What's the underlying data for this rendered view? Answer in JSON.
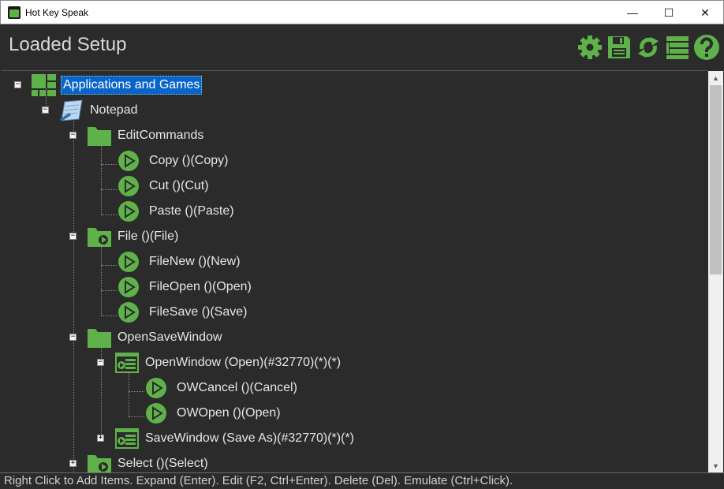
{
  "window": {
    "title": "Hot Key Speak",
    "minimize_glyph": "—",
    "maximize_glyph": "☐",
    "close_glyph": "✕"
  },
  "header": {
    "title": "Loaded Setup"
  },
  "toolbar": [
    {
      "name": "settings-gear-icon"
    },
    {
      "name": "save-disk-icon"
    },
    {
      "name": "refresh-icon"
    },
    {
      "name": "list-icon"
    },
    {
      "name": "help-icon"
    }
  ],
  "colors": {
    "accent_green": "#5fb24a",
    "selection_blue": "#0a64c8",
    "background": "#2b2b2b"
  },
  "tree": {
    "applications": "Applications and Games",
    "notepad": "Notepad",
    "edit_commands": "EditCommands",
    "copy": "Copy ()(Copy)",
    "cut": "Cut ()(Cut)",
    "paste": "Paste ()(Paste)",
    "file": "File ()(File)",
    "file_new": "FileNew ()(New)",
    "file_open": "FileOpen ()(Open)",
    "file_save": "FileSave ()(Save)",
    "open_save_window": "OpenSaveWindow",
    "open_window": "OpenWindow (Open)(#32770)(*)(*)",
    "ow_cancel": "OWCancel ()(Cancel)",
    "ow_open": "OWOpen ()(Open)",
    "save_window": "SaveWindow (Save As)(#32770)(*)(*)",
    "select": "Select ()(Select)"
  },
  "status": {
    "text": "Right Click to Add Items. Expand (Enter). Edit (F2, Ctrl+Enter). Delete (Del). Emulate (Ctrl+Click)."
  },
  "scroll": {
    "up_glyph": "▲",
    "down_glyph": "▼"
  }
}
